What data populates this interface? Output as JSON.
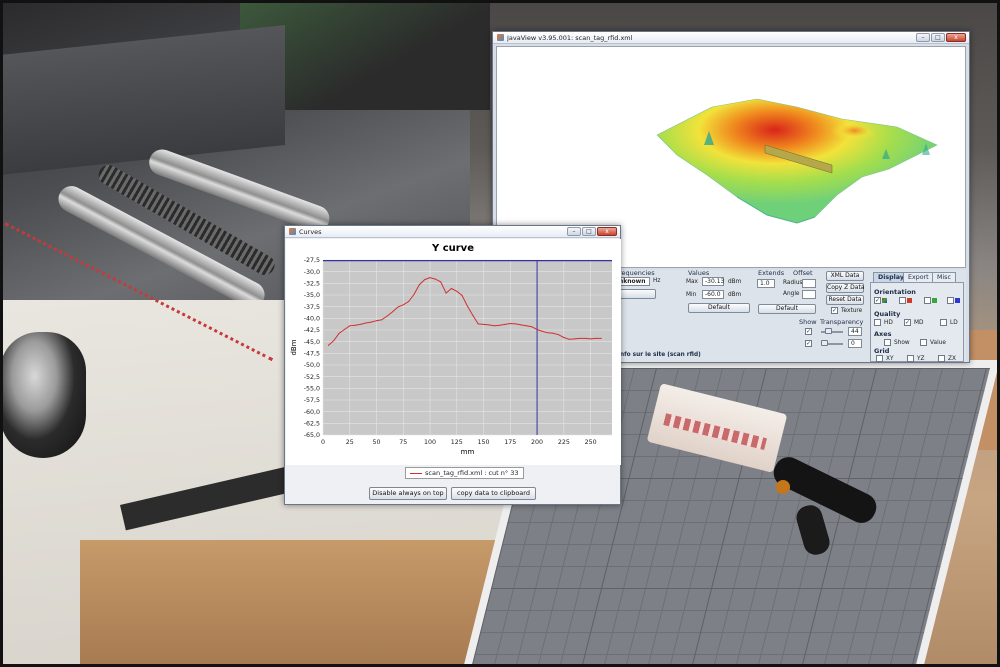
{
  "javaview": {
    "title": "JavaView v3.95.001: scan_tag_rfid.xml",
    "frequencies_label": "requencies",
    "frequency_value": "nknown",
    "frequency_unit": "Hz",
    "values_label": "Values",
    "max_label": "Max",
    "max_value": "-30.13",
    "max_unit": "dBm",
    "min_label": "Min",
    "min_value": "-60.0",
    "min_unit": "dBm",
    "default_label": "Default",
    "extends_label": "Extends",
    "extends_value": "1.0",
    "offset_label": "Offset",
    "radius_label": "Radius",
    "angle_label": "Angle",
    "default2_label": "Default",
    "xml_data": "XML Data",
    "copy_z_data": "Copy Z Data",
    "reset_data": "Reset Data",
    "texture_label": "Texture",
    "show_label": "Show",
    "transparency_label": "Transparency",
    "transparency_value": "44",
    "second_value": "0",
    "info_text": "nfo sur le site (scan rfid)",
    "tabs": [
      "Display",
      "Export",
      "Misc"
    ],
    "orientation_label": "Orientation",
    "quality_label": "Quality",
    "quality_options": [
      "HD",
      "MD",
      "LD"
    ],
    "axes_label": "Axes",
    "axes_options": [
      "Show",
      "Value"
    ],
    "grid_label": "Grid",
    "grid_options": [
      "XY",
      "YZ",
      "ZX"
    ]
  },
  "curves": {
    "window_title": "Curves",
    "disable_always_on_top": "Disable always on top",
    "copy_data": "copy data to clipboard"
  },
  "window_buttons": {
    "minimize": "–",
    "maximize": "□",
    "close": "x"
  },
  "chart_data": {
    "type": "line",
    "title": "Y curve",
    "xlabel": "mm",
    "ylabel": "dBm",
    "xlim": [
      0,
      270
    ],
    "ylim": [
      -65,
      -27.5
    ],
    "x_ticks": [
      0,
      25,
      50,
      75,
      100,
      125,
      150,
      175,
      200,
      225,
      250
    ],
    "y_ticks": [
      "-27,5",
      "-30,0",
      "-32,5",
      "-35,0",
      "-37,5",
      "-40,0",
      "-42,5",
      "-45,0",
      "-47,5",
      "-50,0",
      "-52,5",
      "-55,0",
      "-57,5",
      "-60,0",
      "-62,5",
      "-65,0"
    ],
    "grid": true,
    "legend_position": "bottom-center",
    "series": [
      {
        "name": "scan_tag_rfid.xml : cut n° 33",
        "color": "#d03131",
        "x": [
          5,
          10,
          15,
          20,
          25,
          30,
          35,
          40,
          45,
          50,
          55,
          60,
          65,
          70,
          75,
          80,
          85,
          90,
          95,
          100,
          105,
          110,
          115,
          120,
          125,
          130,
          135,
          140,
          145,
          150,
          155,
          160,
          165,
          170,
          175,
          180,
          185,
          190,
          195,
          200,
          205,
          210,
          215,
          220,
          225,
          230,
          235,
          240,
          245,
          250,
          255,
          260
        ],
        "y": [
          -45.8,
          -44.8,
          -43.2,
          -42.4,
          -41.6,
          -41.5,
          -41.3,
          -41.0,
          -40.8,
          -40.5,
          -40.3,
          -39.5,
          -38.6,
          -37.6,
          -37.1,
          -36.4,
          -34.9,
          -32.8,
          -31.7,
          -31.3,
          -31.6,
          -32.2,
          -34.6,
          -33.6,
          -34.2,
          -35.1,
          -37.4,
          -39.4,
          -41.2,
          -41.3,
          -41.4,
          -41.6,
          -41.5,
          -41.3,
          -41.1,
          -41.2,
          -41.4,
          -41.6,
          -41.8,
          -42.4,
          -42.8,
          -43.1,
          -43.2,
          -43.5,
          -44.1,
          -44.5,
          -44.4,
          -44.3,
          -44.3,
          -44.4,
          -44.3,
          -44.3
        ]
      }
    ],
    "marker_x": 200,
    "marker_color": "#3232a8",
    "top_line_y": -27.5,
    "top_line_color": "#3232a8"
  }
}
